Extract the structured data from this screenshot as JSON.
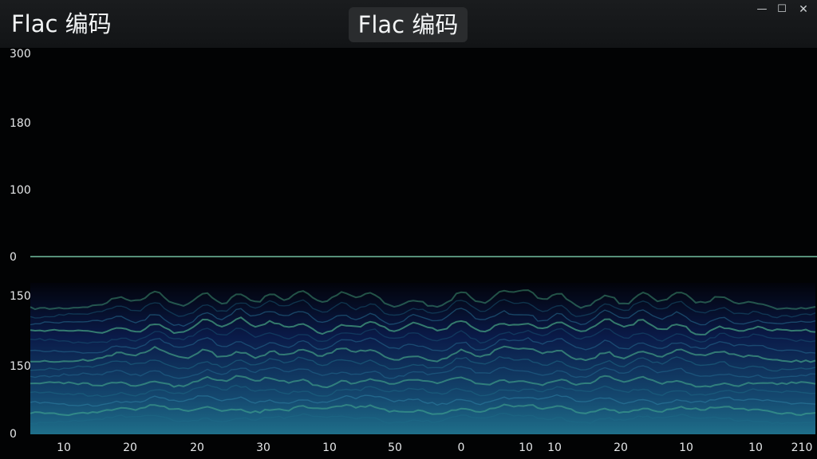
{
  "window": {
    "title": "Flac 编码",
    "center_title": "Flac 编码",
    "controls": {
      "minimize": "—",
      "maximize": "☐",
      "close": "✕"
    }
  },
  "colors": {
    "background": "#020304",
    "waveform": "#48d6b0",
    "waveform_highlight": "#8ef0c8",
    "spectrogram_low": "#0a1a48",
    "spectrogram_mid": "#1f6f8a",
    "spectrogram_high": "#5fe0a0"
  },
  "chart_data": [
    {
      "type": "area",
      "panel": "waveform",
      "y_ticks": [
        "300",
        "180",
        "100",
        "0"
      ],
      "grid": false
    },
    {
      "type": "heatmap",
      "panel": "spectrogram",
      "y_ticks": [
        "150",
        "150",
        "0"
      ],
      "x_ticks": [
        "10",
        "20",
        "20",
        "30",
        "10",
        "50",
        "0",
        "10",
        "10",
        "20",
        "10",
        "10",
        "210"
      ],
      "grid": false
    }
  ]
}
